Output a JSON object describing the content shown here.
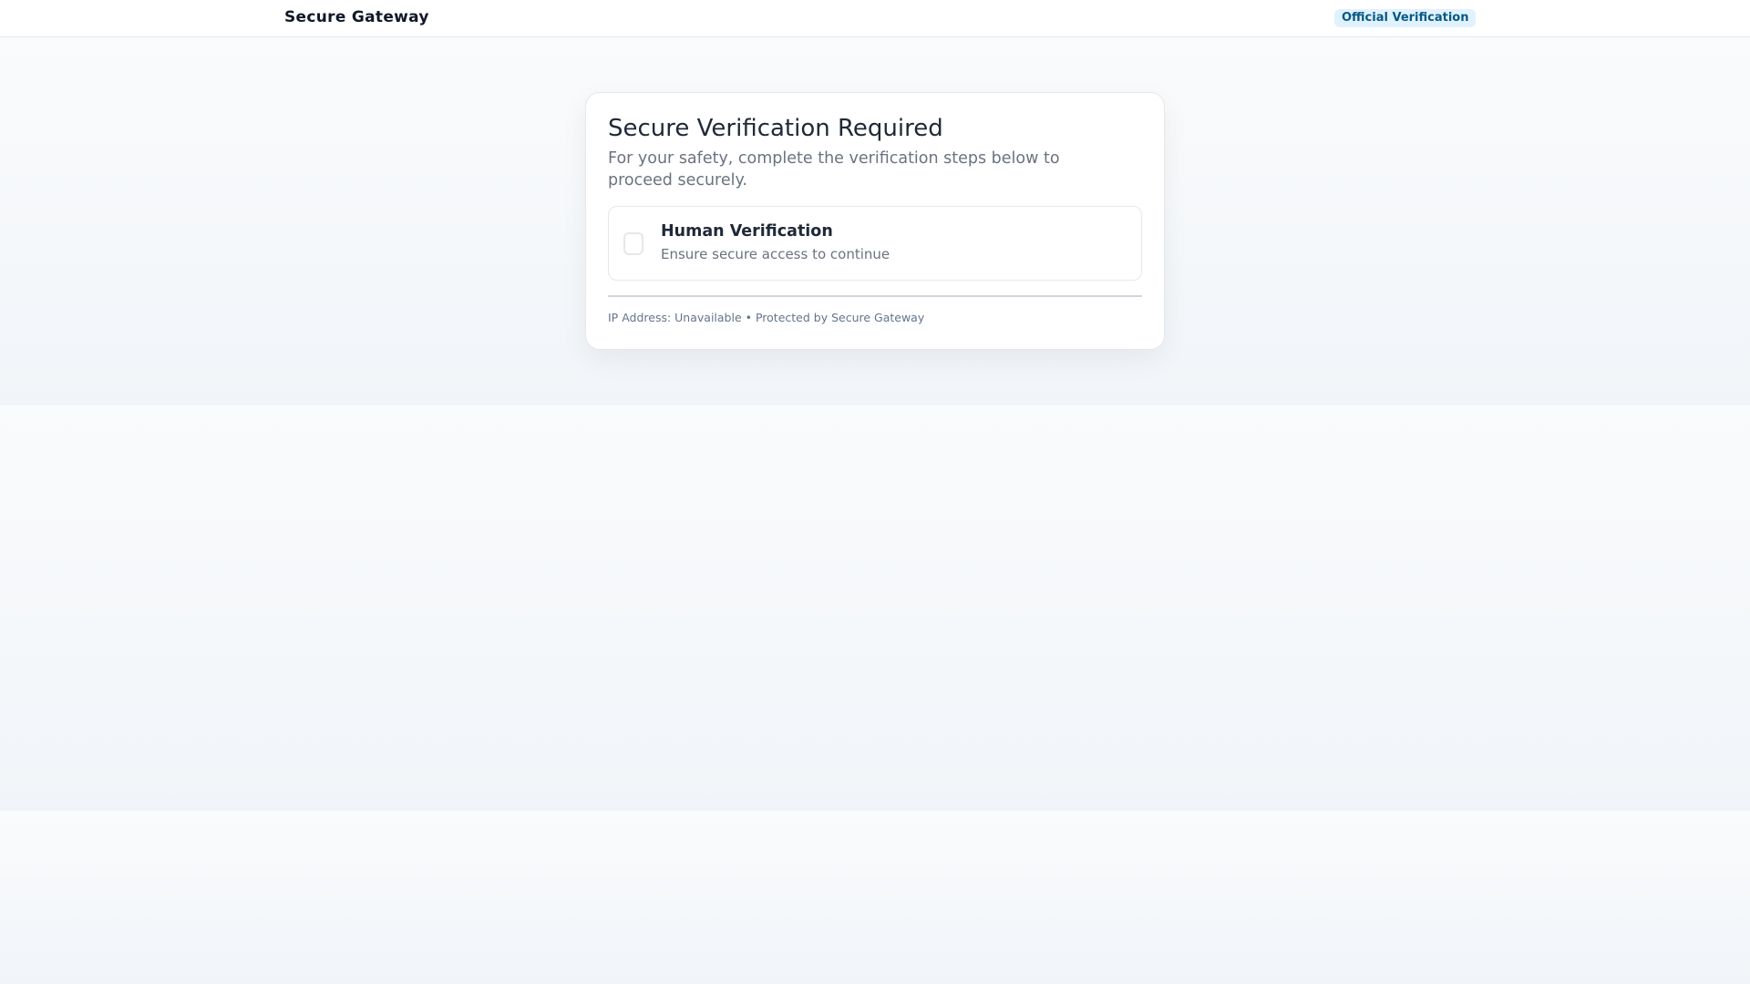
{
  "header": {
    "brand": "Secure Gateway",
    "badge": "Official Verification"
  },
  "card": {
    "title": "Secure Verification Required",
    "subtitle": "For your safety, complete the verification steps below to proceed securely.",
    "step": {
      "title": "Human Verification",
      "description": "Ensure secure access to continue",
      "checked": false
    },
    "footer": "IP Address: Unavailable • Protected by Secure Gateway"
  }
}
